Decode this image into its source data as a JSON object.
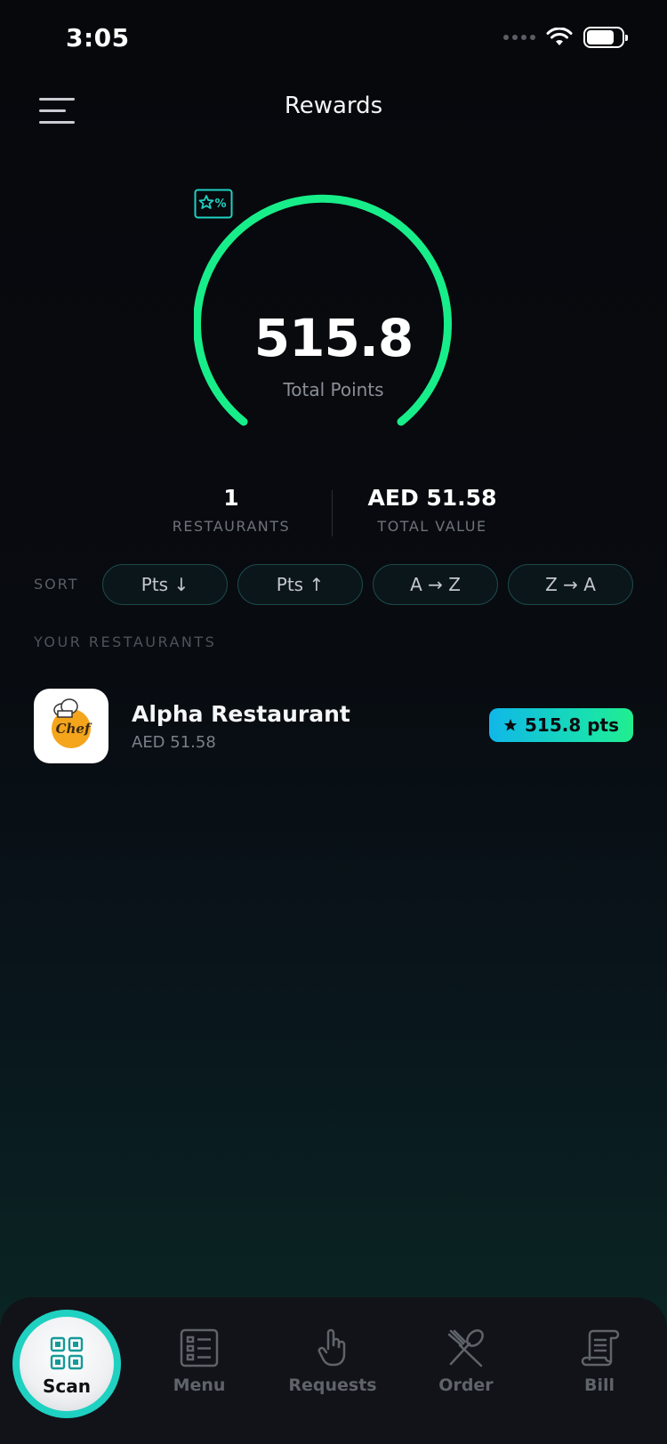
{
  "status_bar": {
    "time": "3:05"
  },
  "header": {
    "title": "Rewards"
  },
  "points": {
    "value": "515.8",
    "label": "Total Points"
  },
  "stats": {
    "restaurants_count": "1",
    "restaurants_label": "RESTAURANTS",
    "total_value": "AED 51.58",
    "total_value_label": "TOTAL VALUE"
  },
  "sort": {
    "label": "SORT",
    "options": [
      "Pts ↓",
      "Pts ↑",
      "A → Z",
      "Z → A"
    ]
  },
  "section_title": "YOUR RESTAURANTS",
  "restaurants": [
    {
      "name": "Alpha Restaurant",
      "value": "AED 51.58",
      "points": "515.8 pts",
      "logo_text": "Chef"
    }
  ],
  "nav": {
    "scan": "Scan",
    "menu": "Menu",
    "requests": "Requests",
    "order": "Order",
    "bill": "Bill"
  },
  "colors": {
    "accent_green": "#17ee8a",
    "accent_teal": "#1fd1c1",
    "badge_cyan": "#10b7e8"
  }
}
